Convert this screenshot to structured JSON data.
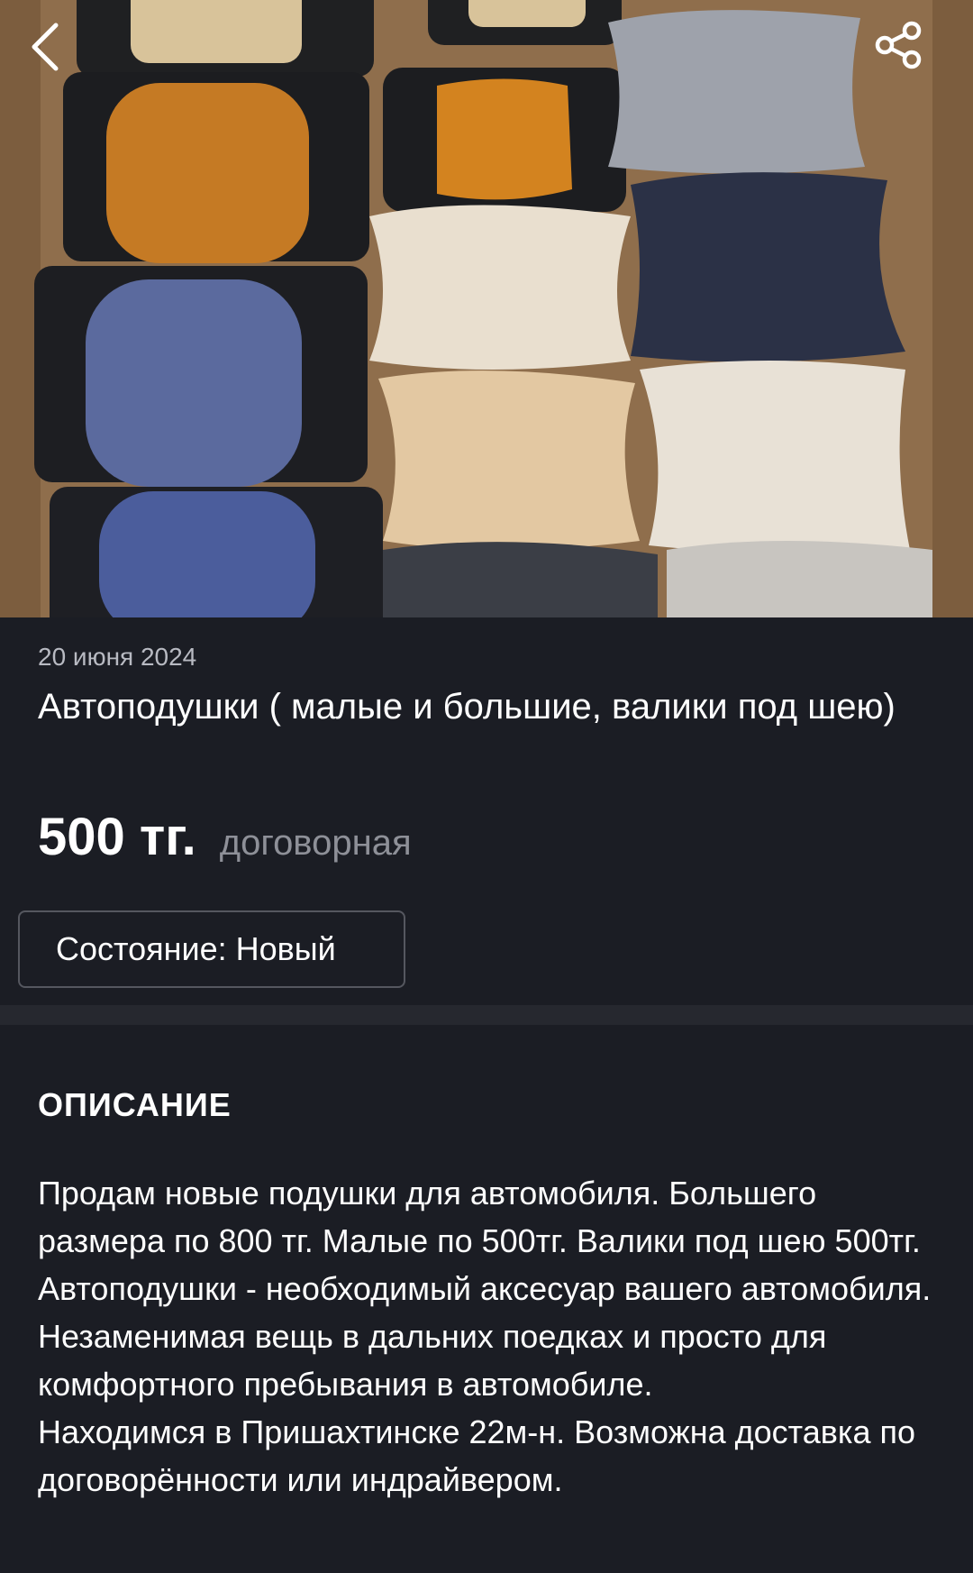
{
  "nav": {
    "back_icon": "chevron-left-icon",
    "share_icon": "share-icon"
  },
  "photo": {
    "subject": "car pillows photo"
  },
  "listing": {
    "date": "20 июня 2024",
    "title": "Автоподушки ( малые и большие, валики под шею)",
    "price": "500 тг.",
    "price_note": "договорная",
    "condition": "Состояние: Новый"
  },
  "description": {
    "heading": "ОПИСАНИЕ",
    "text": "Продам новые подушки для автомобиля. Большего размера по 800 тг. Малые по 500тг. Валики под шею 500тг. Автоподушки - необходимый аксесуар вашего автомобиля. Незаменимая вещь в дальних поедках и просто для комфортного пребывания в автомобиле.\nНаходимся в Пришахтинске 22м-н. Возможна доставка по договорённости или индрайвером."
  },
  "colors": {
    "background": "#1b1d24",
    "divider": "#26282f",
    "muted_text": "#8e9098"
  }
}
